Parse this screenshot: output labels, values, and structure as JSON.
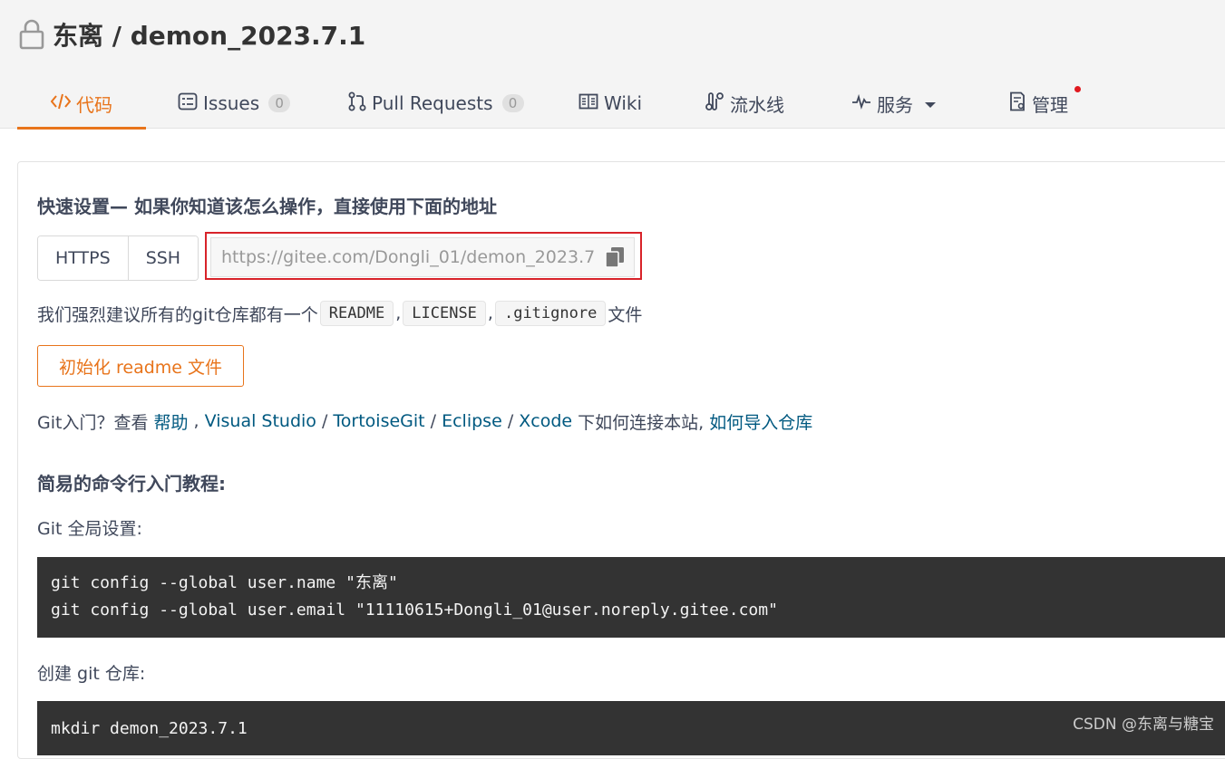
{
  "repo": {
    "title": "东离 / demon_2023.7.1"
  },
  "tabs": [
    {
      "label": "代码",
      "icon": "code-icon",
      "active": true
    },
    {
      "label": "Issues",
      "icon": "issues-icon",
      "count": "0"
    },
    {
      "label": "Pull Requests",
      "icon": "pull-request-icon",
      "count": "0"
    },
    {
      "label": "Wiki",
      "icon": "book-icon"
    },
    {
      "label": "流水线",
      "icon": "pipeline-icon"
    },
    {
      "label": "服务",
      "icon": "pulse-icon",
      "caret": "▾"
    },
    {
      "label": "管理",
      "icon": "settings-doc-icon",
      "notification": true
    }
  ],
  "colors": {
    "accent": "#e8741b",
    "link": "#005980",
    "highlight_border": "#d8232a",
    "code_bg": "#333333"
  },
  "setup": {
    "heading": "快速设置— 如果你知道该怎么操作，直接使用下面的地址",
    "protocols": [
      "HTTPS",
      "SSH"
    ],
    "url_value": "https://gitee.com/Dongli_01/demon_2023.7",
    "recommend_prefix": "我们强烈建议所有的git仓库都有一个",
    "recommend_files": [
      "README",
      "LICENSE",
      ".gitignore"
    ],
    "recommend_sep": ",",
    "recommend_suffix": "文件",
    "init_button": "初始化 readme 文件"
  },
  "help": {
    "prefix": "Git入门？查看 ",
    "links": [
      "帮助",
      "Visual Studio",
      "TortoiseGit",
      "Eclipse",
      "Xcode",
      "如何导入仓库"
    ],
    "sep_comma": " , ",
    "sep_slash": " / ",
    "middle": " 下如何连接本站, "
  },
  "tutorial": {
    "heading": "简易的命令行入门教程:",
    "global_label": "Git 全局设置:",
    "global_code": [
      "git config --global user.name \"东离\"",
      "git config --global user.email \"11110615+Dongli_01@user.noreply.gitee.com\""
    ],
    "create_label": "创建 git 仓库:",
    "create_code": [
      "mkdir demon_2023.7.1"
    ]
  },
  "watermark": "CSDN @东离与糖宝"
}
